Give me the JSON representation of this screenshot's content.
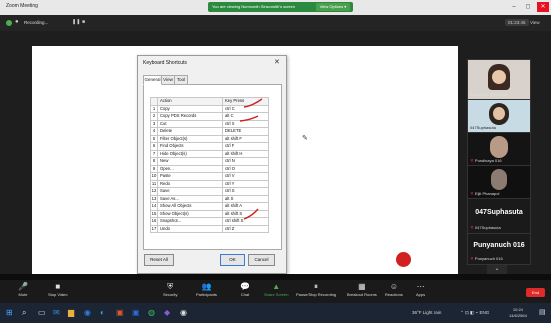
{
  "window": {
    "title": "Zoom Meeting",
    "share_banner": "You are viewing Numnonth Sinsonsith's screen",
    "view_options": "View Options ▾",
    "controls": [
      "–",
      "◻",
      "✕"
    ]
  },
  "meeting_bar": {
    "recording_label": "Recording...",
    "duration": "01:23:45",
    "view_label": "View"
  },
  "dialog": {
    "title": "Keyboard Shortcuts",
    "close": "✕",
    "tabs": [
      "General",
      "View",
      "Tool"
    ],
    "columns": [
      "Action",
      "Key Press"
    ],
    "rows": [
      {
        "n": "1",
        "action": "Copy",
        "key": "ctrl C"
      },
      {
        "n": "2",
        "action": "Copy PDS Records",
        "key": "alt C"
      },
      {
        "n": "3",
        "action": "Cut",
        "key": "ctrl X"
      },
      {
        "n": "4",
        "action": "Delete",
        "key": "DELETE"
      },
      {
        "n": "5",
        "action": "Filter Object(s)",
        "key": "alt shift F"
      },
      {
        "n": "6",
        "action": "Find Objects",
        "key": "ctrl F"
      },
      {
        "n": "7",
        "action": "Hide Object(s)",
        "key": "alt shift H"
      },
      {
        "n": "8",
        "action": "New",
        "key": "ctrl N"
      },
      {
        "n": "9",
        "action": "Open...",
        "key": "ctrl O"
      },
      {
        "n": "10",
        "action": "Paste",
        "key": "ctrl V"
      },
      {
        "n": "11",
        "action": "Redo",
        "key": "ctrl Y"
      },
      {
        "n": "12",
        "action": "Save",
        "key": "ctrl S"
      },
      {
        "n": "13",
        "action": "Save As...",
        "key": "alt S"
      },
      {
        "n": "14",
        "action": "Show All Objects",
        "key": "alt shift A"
      },
      {
        "n": "15",
        "action": "Show Object(s)",
        "key": "alt shift S"
      },
      {
        "n": "16",
        "action": "Snapshot...",
        "key": "ctrl shift S"
      },
      {
        "n": "17",
        "action": "Undo",
        "key": "ctrl Z"
      }
    ],
    "reset_all": "Reset All",
    "ok": "OK",
    "cancel": "Cancel"
  },
  "participants": [
    {
      "name": "Numnonth Sinsonsith"
    },
    {
      "name": "047Suphasuta"
    },
    {
      "name": "Pundinaya 016"
    },
    {
      "name": "Eijit Phanapol"
    },
    {
      "big": "047Suphasuta",
      "name": "047Suphasuta"
    },
    {
      "big": "Punyanuch 016",
      "name": "Punyanuch 016"
    }
  ],
  "toolbar": [
    {
      "icon": "🎤",
      "label": "Mute"
    },
    {
      "icon": "■",
      "label": "Stop Video"
    },
    {
      "icon": "⛨",
      "label": "Security"
    },
    {
      "icon": "👥",
      "label": "Participants"
    },
    {
      "icon": "💬",
      "label": "Chat"
    },
    {
      "icon": "▲",
      "label": "Share Screen"
    },
    {
      "icon": "⏸",
      "label": "Pause/Stop Recording"
    },
    {
      "icon": "▦",
      "label": "Breakout Rooms"
    },
    {
      "icon": "☺",
      "label": "Reactions"
    },
    {
      "icon": "⋯",
      "label": "Apps"
    }
  ],
  "end_button": "End",
  "taskbar": {
    "weather": "36°F  Light rain",
    "time": "10:24",
    "date": "14/6/2564"
  },
  "colors": {
    "share_green": "#2b8a3e",
    "end_red": "#e02a2a",
    "annotation_red": "#d21f1f"
  }
}
